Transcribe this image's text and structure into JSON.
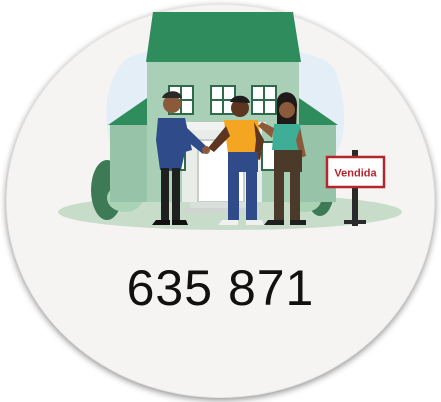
{
  "sign": {
    "label": "Vendida"
  },
  "figure": {
    "number": "635 871"
  },
  "colors": {
    "roof": "#2f8d5d",
    "house_wall": "#a9d0b7",
    "badge_background": "#f6f4f3",
    "sign_text": "#b3262c"
  }
}
